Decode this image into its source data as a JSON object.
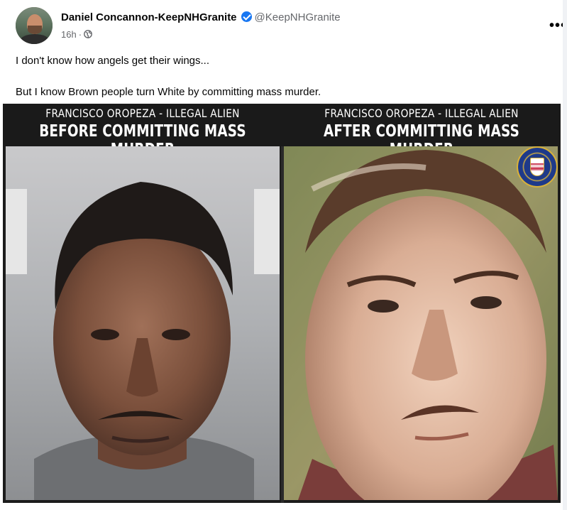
{
  "post": {
    "author_name": "Daniel Concannon-KeepNHGranite",
    "handle": "@KeepNHGranite",
    "timestamp": "16h",
    "separator": "·",
    "privacy_icon": "globe-icon",
    "verified_icon": "verified-badge-icon",
    "more_label": "•••",
    "text_line1": "I don't know how angels get their wings...",
    "text_line2": "But I know Brown people turn White by committing mass murder."
  },
  "image": {
    "left": {
      "caption_top": "FRANCISCO OROPEZA - ILLEGAL ALIEN",
      "caption_bottom": "BEFORE COMMITTING MASS MURDER"
    },
    "right": {
      "caption_top": "FRANCISCO OROPEZA - ILLEGAL ALIEN",
      "caption_bottom": "AFTER COMMITTING MASS MURDER"
    },
    "seal": "fbi-seal-icon"
  },
  "colors": {
    "verified_blue": "#1877f2",
    "meta_gray": "#65676b",
    "text": "#050505"
  }
}
